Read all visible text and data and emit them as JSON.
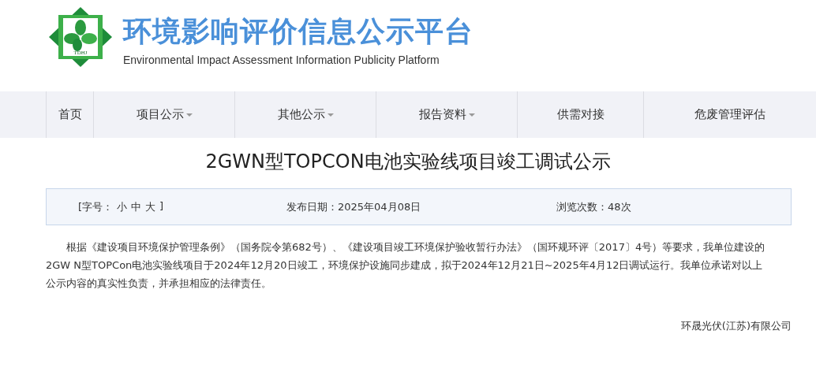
{
  "header": {
    "logo_text": "TDHJ",
    "title": "环境影响评价信息公示平台",
    "subtitle": "Environmental Impact Assessment Information Publicity Platform"
  },
  "nav": [
    {
      "label": "首页",
      "dropdown": false
    },
    {
      "label": "项目公示",
      "dropdown": true
    },
    {
      "label": "其他公示",
      "dropdown": true
    },
    {
      "label": "报告资料",
      "dropdown": true
    },
    {
      "label": "供需对接",
      "dropdown": false
    },
    {
      "label": "危废管理评估",
      "dropdown": false
    }
  ],
  "article": {
    "title": "2GWN型TOPCON电池实验线项目竣工调试公示",
    "font_size": {
      "label": "[字号：",
      "options": [
        "小",
        "中",
        "大"
      ],
      "close": "]"
    },
    "publish_date": "发布日期：2025年04月08日",
    "views": "浏览次数：48次",
    "body": "根据《建设项目环境保护管理条例》（国务院令第682号）、《建设项目竣工环境保护验收暂行办法》（国环规环评〔2017〕4号）等要求，我单位建设的2GW N型TOPCon电池实验线项目于2024年12月20日竣工，环境保护设施同步建成，拟于2024年12月21日~2025年4月12日调试运行。我单位承诺对以上公示内容的真实性负责，并承担相应的法律责任。",
    "signature": "环晟光伏(江苏)有限公司"
  }
}
